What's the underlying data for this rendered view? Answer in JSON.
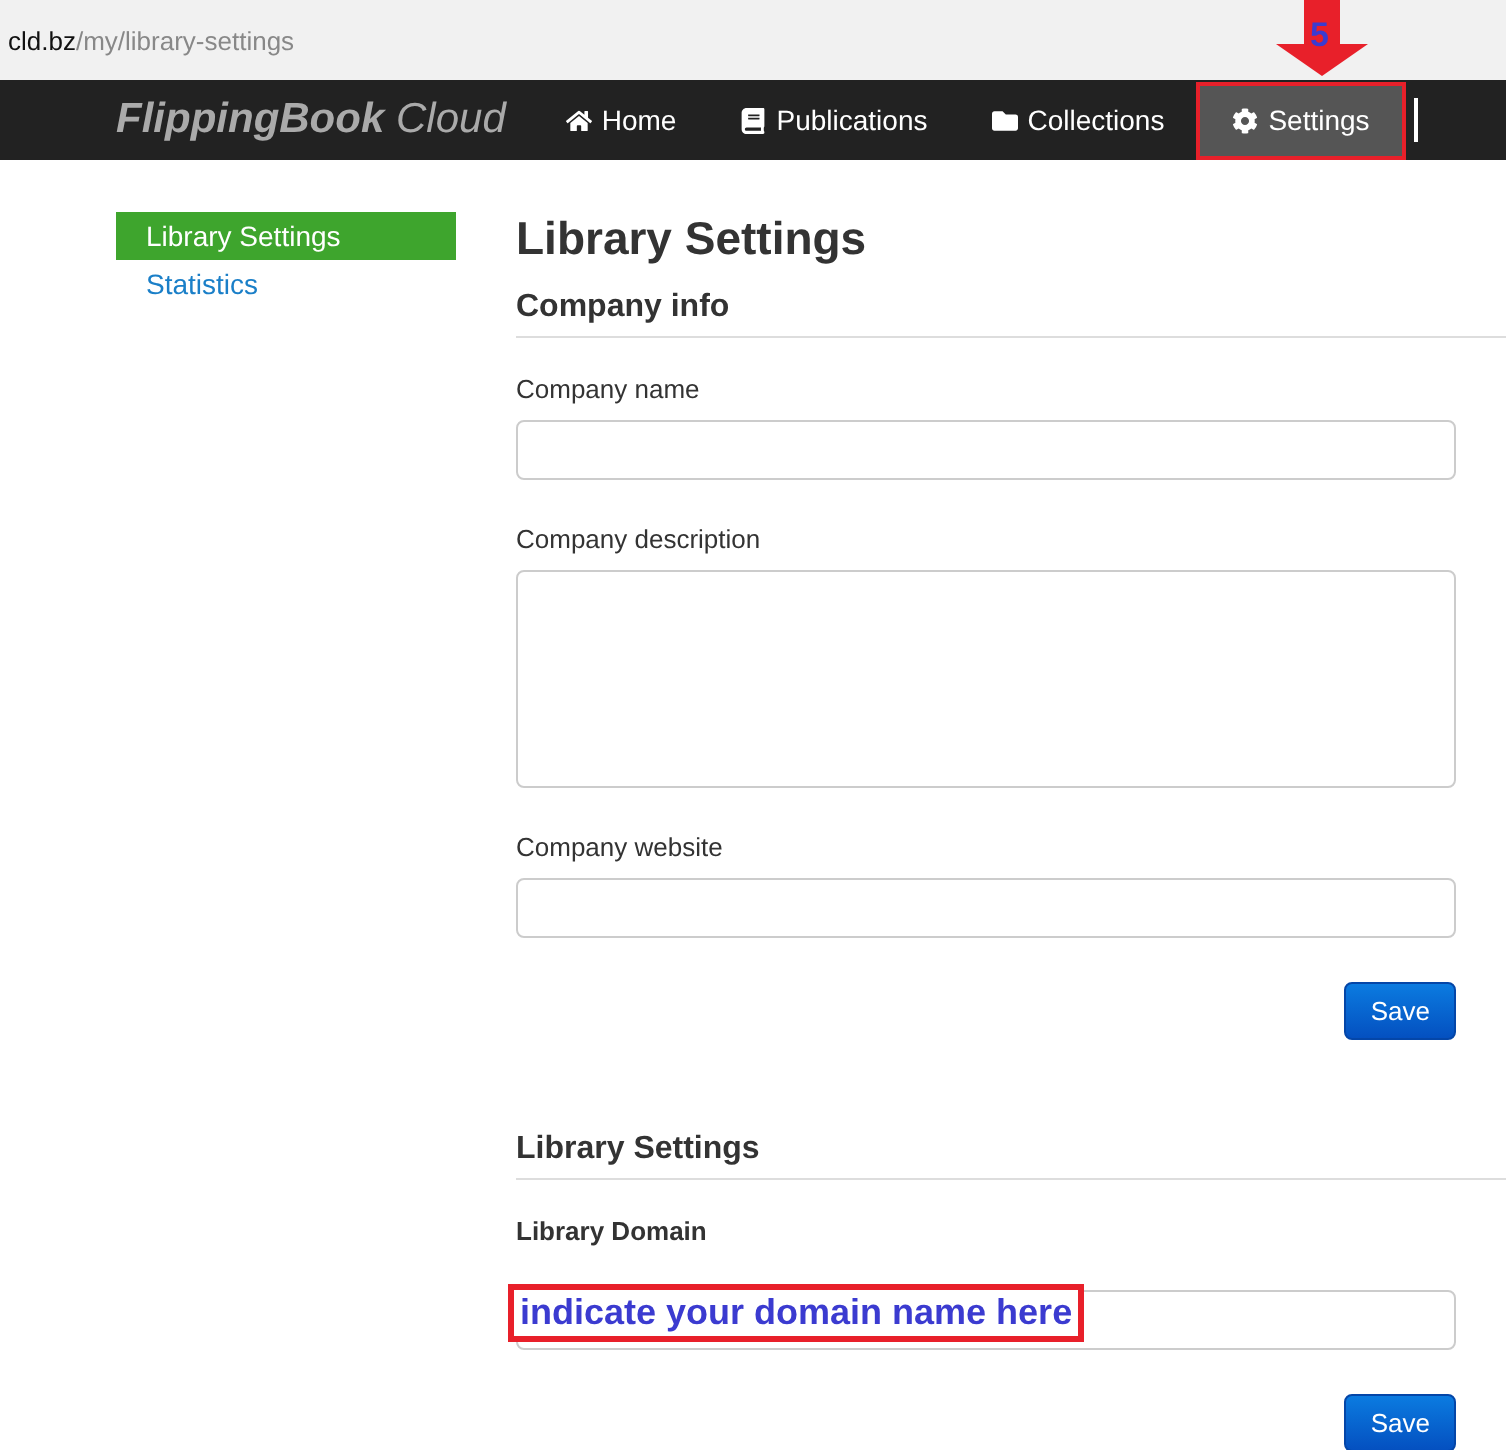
{
  "address_bar": {
    "domain": "cld.bz",
    "path": "/my/library-settings"
  },
  "brand": {
    "name": "FlippingBook",
    "suffix": "Cloud"
  },
  "nav": [
    {
      "label": "Home",
      "kind": "home",
      "selected": false,
      "highlighted": false
    },
    {
      "label": "Publications",
      "kind": "book",
      "selected": false,
      "highlighted": false
    },
    {
      "label": "Collections",
      "kind": "folder",
      "selected": false,
      "highlighted": false
    },
    {
      "label": "Settings",
      "kind": "gear",
      "selected": true,
      "highlighted": true
    }
  ],
  "step_marker": {
    "number": "5"
  },
  "sidebar": {
    "items": [
      {
        "label": "Library Settings",
        "selected": true
      },
      {
        "label": "Statistics",
        "selected": false
      }
    ]
  },
  "page_title": "Library Settings",
  "sections": [
    {
      "heading": "Company info",
      "fields": [
        {
          "label": "Company name",
          "kind": "text"
        },
        {
          "label": "Company description",
          "kind": "textarea"
        },
        {
          "label": "Company website",
          "kind": "text"
        }
      ],
      "button": "Save"
    },
    {
      "heading": "Library Settings",
      "fields": [
        {
          "label": "Library Domain",
          "kind": "text",
          "bold_label": true,
          "annotation": "indicate your domain name here"
        }
      ],
      "button": "Save"
    }
  ]
}
